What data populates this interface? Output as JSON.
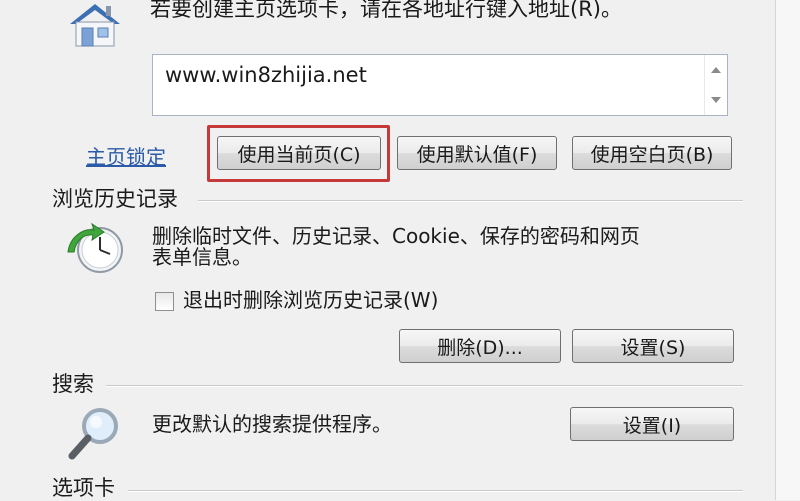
{
  "homepage": {
    "instruction": "若要创建主页选项卡，请在各地址行键入地址(R)。",
    "url_value": "www.win8zhijia.net",
    "lock_link": "主页锁定",
    "buttons": {
      "use_current": "使用当前页(C)",
      "use_default": "使用默认值(F)",
      "use_blank": "使用空白页(B)"
    }
  },
  "history": {
    "title": "浏览历史记录",
    "description_line1": "删除临时文件、历史记录、Cookie、保存的密码和网页",
    "description_line2": "表单信息。",
    "checkbox_label": "退出时删除浏览历史记录(W)",
    "delete_button": "删除(D)...",
    "settings_button": "设置(S)"
  },
  "search": {
    "title": "搜索",
    "description": "更改默认的搜索提供程序。",
    "settings_button": "设置(I)"
  },
  "tabs": {
    "title": "选项卡"
  },
  "icons": {
    "home": "house-icon",
    "history": "history-clock-icon",
    "search": "magnifier-icon"
  },
  "colors": {
    "highlight": "#c43a3a",
    "link": "#2a5aa8"
  }
}
